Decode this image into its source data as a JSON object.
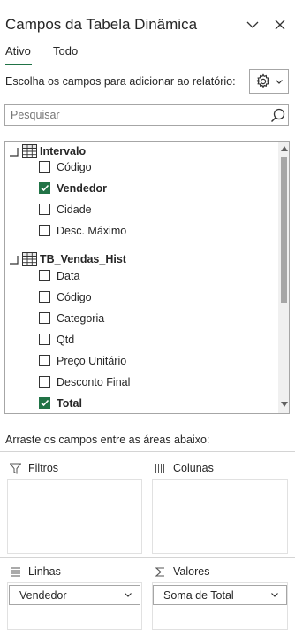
{
  "header": {
    "title": "Campos da Tabela Dinâmica"
  },
  "tabs": [
    {
      "label": "Ativo",
      "active": true
    },
    {
      "label": "Todo",
      "active": false
    }
  ],
  "instructions": "Escolha os campos para adicionar ao relatório:",
  "search": {
    "placeholder": "Pesquisar",
    "value": ""
  },
  "field_list": {
    "groups": [
      {
        "name": "Intervalo",
        "fields": [
          {
            "label": "Código",
            "checked": false
          },
          {
            "label": "Vendedor",
            "checked": true
          },
          {
            "label": "Cidade",
            "checked": false
          },
          {
            "label": "Desc. Máximo",
            "checked": false
          }
        ]
      },
      {
        "name": "TB_Vendas_Hist",
        "fields": [
          {
            "label": "Data",
            "checked": false
          },
          {
            "label": "Código",
            "checked": false
          },
          {
            "label": "Categoria",
            "checked": false
          },
          {
            "label": "Qtd",
            "checked": false
          },
          {
            "label": "Preço Unitário",
            "checked": false
          },
          {
            "label": "Desconto Final",
            "checked": false
          },
          {
            "label": "Total",
            "checked": true
          }
        ]
      }
    ]
  },
  "drag_instructions": "Arraste os campos entre as áreas abaixo:",
  "areas": {
    "filters": {
      "label": "Filtros",
      "items": []
    },
    "columns": {
      "label": "Colunas",
      "items": []
    },
    "rows": {
      "label": "Linhas",
      "items": [
        "Vendedor"
      ]
    },
    "values": {
      "label": "Valores",
      "items": [
        "Soma de Total"
      ]
    }
  },
  "colors": {
    "accent": "#217346",
    "border": "#a6a6a6",
    "text": "#262626"
  }
}
